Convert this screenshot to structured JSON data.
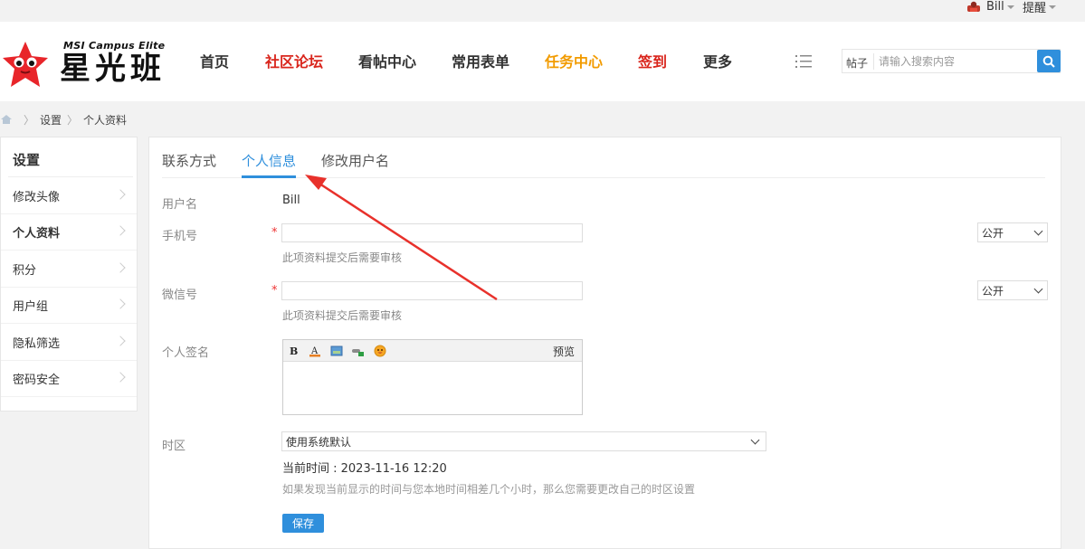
{
  "topbar": {
    "user_name": "Bill",
    "remind_label": "提醒"
  },
  "logo": {
    "en_text": "MSI Campus Elite",
    "cn_text": "星光班"
  },
  "nav": {
    "items": [
      {
        "label": "首页",
        "color": "#333333"
      },
      {
        "label": "社区论坛",
        "color": "#d9251c"
      },
      {
        "label": "看帖中心",
        "color": "#333333"
      },
      {
        "label": "常用表单",
        "color": "#333333"
      },
      {
        "label": "任务中心",
        "color": "#f29b00"
      },
      {
        "label": "签到",
        "color": "#d9251c"
      },
      {
        "label": "更多",
        "color": "#333333"
      }
    ]
  },
  "search": {
    "type_label": "帖子",
    "placeholder": "请输入搜索内容"
  },
  "breadcrumb": {
    "items": [
      "设置",
      "个人资料"
    ]
  },
  "sidebar": {
    "title": "设置",
    "items": [
      {
        "label": "修改头像"
      },
      {
        "label": "个人资料"
      },
      {
        "label": "积分"
      },
      {
        "label": "用户组"
      },
      {
        "label": "隐私筛选"
      },
      {
        "label": "密码安全"
      }
    ]
  },
  "tabs": [
    {
      "label": "联系方式"
    },
    {
      "label": "个人信息"
    },
    {
      "label": "修改用户名"
    }
  ],
  "form": {
    "username_label": "用户名",
    "username_value": "Bill",
    "phone_label": "手机号",
    "phone_value": "",
    "phone_privacy": "公开",
    "phone_hint": "此项资料提交后需要审核",
    "wechat_label": "微信号",
    "wechat_value": "",
    "wechat_privacy": "公开",
    "wechat_hint": "此项资料提交后需要审核",
    "required_mark": "*",
    "signature_label": "个人签名",
    "signature_preview": "预览",
    "timezone_label": "时区",
    "timezone_value": "使用系统默认",
    "current_time": "当前时间 : 2023-11-16 12:20",
    "timezone_hint": "如果发现当前显示的时间与您本地时间相差几个小时，那么您需要更改自己的时区设置",
    "save_label": "保存"
  },
  "colors": {
    "accent": "#2f8fdc",
    "annotation_arrow": "#e8312b"
  }
}
